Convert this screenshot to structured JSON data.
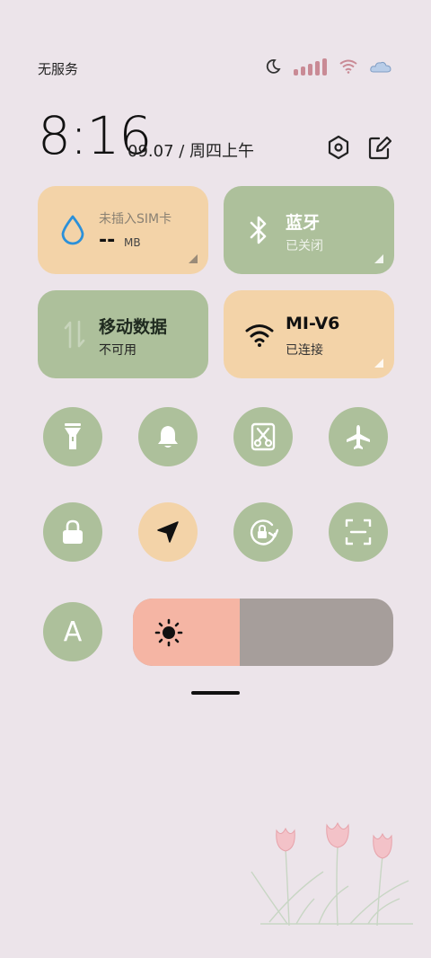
{
  "status": {
    "carrier": "无服务",
    "icons": [
      "moon-icon",
      "signal-icon",
      "wifi-icon",
      "cloud-icon"
    ]
  },
  "clock": {
    "time": "8:16",
    "date": "09.07 / 周四上午"
  },
  "header_icons": [
    "settings-icon",
    "edit-icon"
  ],
  "tiles": {
    "data_usage": {
      "title": "未插入SIM卡",
      "value": "--",
      "unit": "MB",
      "icon": "droplet-icon"
    },
    "bluetooth": {
      "title": "蓝牙",
      "status": "已关闭",
      "icon": "bluetooth-icon"
    },
    "mobile_data": {
      "title": "移动数据",
      "status": "不可用",
      "icon": "data-arrows-icon"
    },
    "wifi": {
      "title": "MI-V6",
      "status": "已连接",
      "icon": "wifi-icon"
    }
  },
  "toggles_row1": [
    "flashlight-icon",
    "bell-icon",
    "screenshot-icon",
    "airplane-icon"
  ],
  "toggles_row2": [
    "lock-icon",
    "location-icon",
    "rotation-lock-icon",
    "scan-icon"
  ],
  "auto_brightness": {
    "label": "A"
  },
  "brightness": {
    "level": 0.41,
    "icon": "sun-icon"
  },
  "colors": {
    "background": "#ece4ea",
    "tile_green": "#adc09b",
    "tile_orange": "#f3d3a8",
    "brightness_fill": "#f5b5a4",
    "brightness_track": "#a69e9b"
  }
}
